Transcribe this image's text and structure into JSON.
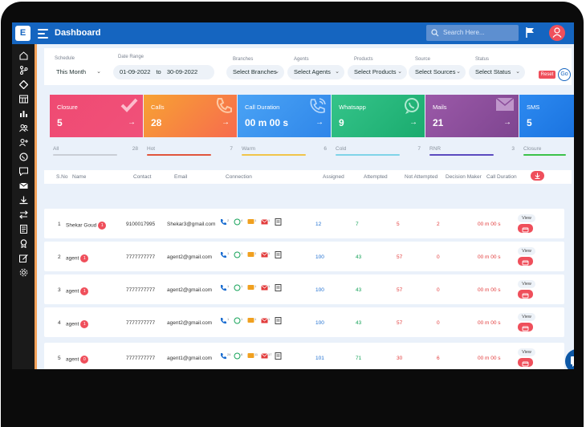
{
  "app": {
    "logo_letter": "E",
    "title": "Dashboard",
    "search_placeholder": "Search Here..."
  },
  "filters": {
    "schedule": {
      "label": "Schedule",
      "value": "This Month"
    },
    "date_range": {
      "label": "Date Range",
      "from": "01-09-2022",
      "to_word": "to",
      "to": "30-09-2022"
    },
    "branches": {
      "label": "Branches",
      "value": "Select Branches"
    },
    "agents": {
      "label": "Agents",
      "value": "Select Agents"
    },
    "products": {
      "label": "Products",
      "value": "Select Products"
    },
    "source": {
      "label": "Source",
      "value": "Select Sources"
    },
    "status": {
      "label": "Status",
      "value": "Select Status"
    },
    "reset_label": "Reset",
    "go_label": "Go"
  },
  "cards": [
    {
      "title": "Closure",
      "value": "5",
      "arrow": "→",
      "color_from": "#ef4a72",
      "color_to": "#f0517a"
    },
    {
      "title": "Calls",
      "value": "28",
      "arrow": "→",
      "color_from": "#f7a233",
      "color_to": "#f76b4e"
    },
    {
      "title": "Call Duration",
      "value": "00 m 00 s",
      "arrow": "→",
      "color_from": "#4aa3f5",
      "color_to": "#2f86e9"
    },
    {
      "title": "Whatsapp",
      "value": "9",
      "arrow": "→",
      "color_from": "#35c48a",
      "color_to": "#1aab6e"
    },
    {
      "title": "Mails",
      "value": "21",
      "arrow": "→",
      "color_from": "#9b59a8",
      "color_to": "#7e4590"
    },
    {
      "title": "SMS",
      "value": "5",
      "arrow": "",
      "color_from": "#2d8af0",
      "color_to": "#1a73e0"
    }
  ],
  "progress": [
    {
      "label": "All",
      "count": "28",
      "color": "#c9ced6",
      "fraction": 0.75
    },
    {
      "label": "Hot",
      "count": "7",
      "color": "#e0553c",
      "fraction": 0.75
    },
    {
      "label": "Warm",
      "count": "6",
      "color": "#f0c44a",
      "fraction": 0.75
    },
    {
      "label": "Cold",
      "count": "7",
      "color": "#7fd4e8",
      "fraction": 0.75
    },
    {
      "label": "RNR",
      "count": "3",
      "color": "#5b4bbf",
      "fraction": 0.75
    },
    {
      "label": "Closure",
      "count": "",
      "color": "#3cc24a",
      "fraction": 1.0
    }
  ],
  "table": {
    "headers": {
      "sno": "S.No",
      "name": "Name",
      "contact": "Contact",
      "email": "Email",
      "connection": "Connection",
      "assigned": "Assigned",
      "attempted": "Attempted",
      "not_attempted": "Not Attempted",
      "decision_maker": "Decision Maker",
      "call_duration": "Call Duration"
    },
    "view_label": "View",
    "rows": [
      {
        "sno": "1",
        "name": "Shekar Goud",
        "badge": "1",
        "contact": "9100017995",
        "email": "Shekar3@gmail.com",
        "conn_counts": [
          "2",
          "4",
          "1",
          "1"
        ],
        "assigned": "12",
        "attempted": "7",
        "not_attempted": "5",
        "decision_maker": "2",
        "call_duration": "00 m 00 s"
      },
      {
        "sno": "2",
        "name": "agent",
        "badge": "1",
        "contact": "7777777777",
        "email": "agent2@gmail.com",
        "conn_counts": [
          "1",
          "1",
          "1",
          "1"
        ],
        "assigned": "100",
        "attempted": "43",
        "not_attempted": "57",
        "decision_maker": "0",
        "call_duration": "00 m 00 s"
      },
      {
        "sno": "3",
        "name": "agent",
        "badge": "1",
        "contact": "7777777777",
        "email": "agent2@gmail.com",
        "conn_counts": [
          "1",
          "1",
          "1",
          "1"
        ],
        "assigned": "100",
        "attempted": "43",
        "not_attempted": "57",
        "decision_maker": "0",
        "call_duration": "00 m 00 s"
      },
      {
        "sno": "4",
        "name": "agent",
        "badge": "1",
        "contact": "7777777777",
        "email": "agent2@gmail.com",
        "conn_counts": [
          "1",
          "1",
          "1",
          "1"
        ],
        "assigned": "100",
        "attempted": "43",
        "not_attempted": "57",
        "decision_maker": "0",
        "call_duration": "00 m 00 s"
      },
      {
        "sno": "5",
        "name": "agent",
        "badge": "0",
        "contact": "7777777777",
        "email": "agent1@gmail.com",
        "conn_counts": [
          "24",
          "8",
          "11",
          "17"
        ],
        "assigned": "101",
        "attempted": "71",
        "not_attempted": "30",
        "decision_maker": "6",
        "call_duration": "00 m 00 s"
      }
    ]
  },
  "colors": {
    "topbar": "#1565c0",
    "accent_red": "#ef4f5b",
    "blue_text": "#1e6fd1",
    "green_text": "#17a35a",
    "red_text": "#e23b3b"
  }
}
